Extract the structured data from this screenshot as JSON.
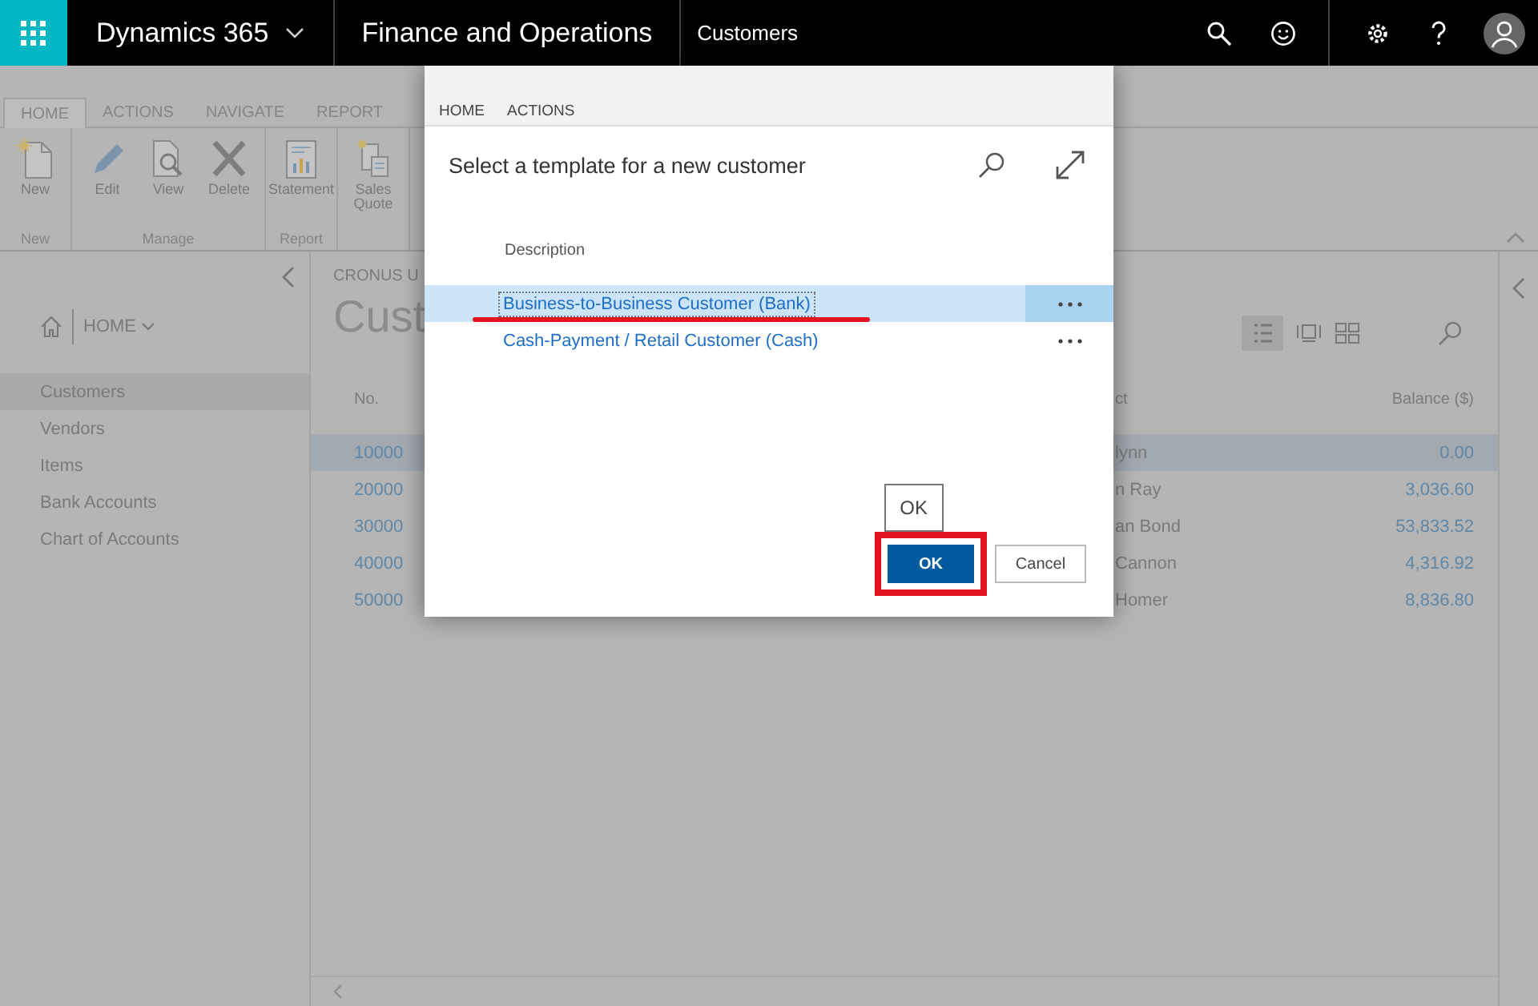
{
  "top_bar": {
    "app_name": "Dynamics 365",
    "module": "Finance and Operations",
    "page": "Customers"
  },
  "ribbon": {
    "tabs": [
      {
        "label": "HOME",
        "selected": true
      },
      {
        "label": "ACTIONS",
        "selected": false
      },
      {
        "label": "NAVIGATE",
        "selected": false
      },
      {
        "label": "REPORT",
        "selected": false
      }
    ],
    "groups": [
      {
        "label": "New",
        "actions": [
          {
            "label": "New",
            "kind": "new"
          }
        ]
      },
      {
        "label": "Manage",
        "actions": [
          {
            "label": "Edit",
            "kind": "edit"
          },
          {
            "label": "View",
            "kind": "view"
          },
          {
            "label": "Delete",
            "kind": "delete"
          }
        ]
      },
      {
        "label": "Report",
        "actions": [
          {
            "label": "Statement",
            "kind": "statement"
          }
        ]
      },
      {
        "actions": [
          {
            "label": "Sales Quote",
            "kind": "quote"
          }
        ]
      }
    ]
  },
  "nav": {
    "home": "HOME",
    "items": [
      {
        "label": "Customers",
        "selected": true
      },
      {
        "label": "Vendors",
        "selected": false
      },
      {
        "label": "Items",
        "selected": false
      },
      {
        "label": "Bank Accounts",
        "selected": false
      },
      {
        "label": "Chart of Accounts",
        "selected": false
      }
    ]
  },
  "list": {
    "company": "CRONUS U",
    "title": "Cust",
    "columns": [
      {
        "label": "No."
      },
      {
        "label": "ct"
      },
      {
        "label": "Balance ($)"
      }
    ],
    "rows": [
      {
        "no": "10000",
        "contact": "lynn",
        "balance": "0.00",
        "selected": true
      },
      {
        "no": "20000",
        "contact": "n Ray",
        "balance": "3,036.60",
        "selected": false
      },
      {
        "no": "30000",
        "contact": "an Bond",
        "balance": "53,833.52",
        "selected": false
      },
      {
        "no": "40000",
        "contact": "Cannon",
        "balance": "4,316.92",
        "selected": false
      },
      {
        "no": "50000",
        "contact": "Homer",
        "balance": "8,836.80",
        "selected": false
      }
    ]
  },
  "dialog": {
    "tabs": [
      {
        "label": "HOME",
        "selected": false
      },
      {
        "label": "ACTIONS",
        "selected": false
      }
    ],
    "title": "Select a template for a new customer",
    "column": "Description",
    "rows": [
      {
        "label": "Business-to-Business Customer (Bank)",
        "selected": true,
        "underlined": true
      },
      {
        "label": "Cash-Payment / Retail Customer (Cash)",
        "selected": false,
        "underlined": false
      }
    ],
    "tooltip": "OK",
    "ok": {
      "label": "OK",
      "highlighted": true
    },
    "cancel": "Cancel"
  }
}
